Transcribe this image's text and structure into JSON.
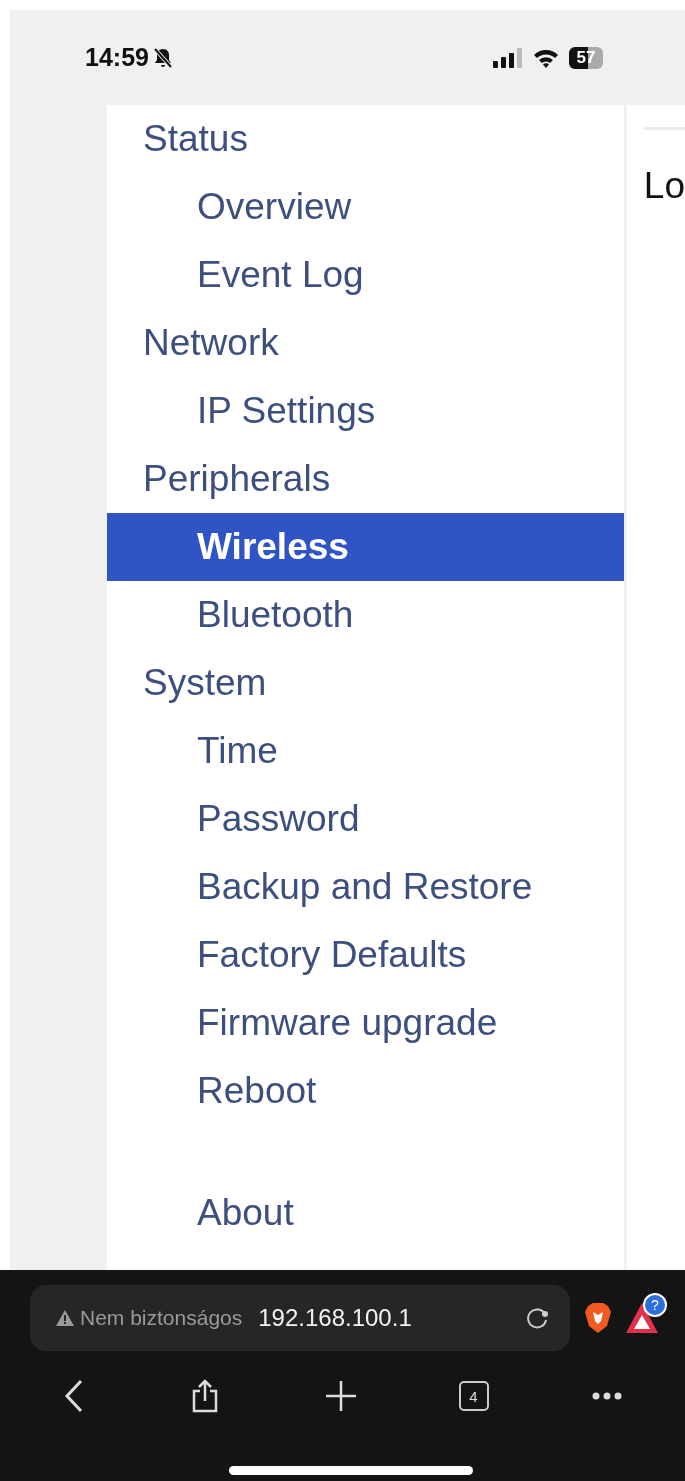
{
  "status_bar": {
    "time": "14:59",
    "battery": "57"
  },
  "sidebar": {
    "groups": [
      {
        "label": "Status",
        "children": [
          {
            "label": "Overview",
            "selected": false
          },
          {
            "label": "Event Log",
            "selected": false
          }
        ]
      },
      {
        "label": "Network",
        "children": [
          {
            "label": "IP Settings",
            "selected": false
          }
        ]
      },
      {
        "label": "Peripherals",
        "children": [
          {
            "label": "Wireless",
            "selected": true
          },
          {
            "label": "Bluetooth",
            "selected": false
          }
        ]
      },
      {
        "label": "System",
        "children": [
          {
            "label": "Time",
            "selected": false
          },
          {
            "label": "Password",
            "selected": false
          },
          {
            "label": "Backup and Restore",
            "selected": false
          },
          {
            "label": "Factory Defaults",
            "selected": false
          },
          {
            "label": "Firmware upgrade",
            "selected": false
          },
          {
            "label": "Reboot",
            "selected": false
          }
        ]
      }
    ],
    "footer_items": [
      {
        "label": "About",
        "selected": false
      }
    ]
  },
  "content": {
    "heading": "Lo"
  },
  "browser": {
    "security_label": "Nem biztonságos",
    "url": "192.168.100.1",
    "extension_badge": "?",
    "tab_count": "4"
  }
}
